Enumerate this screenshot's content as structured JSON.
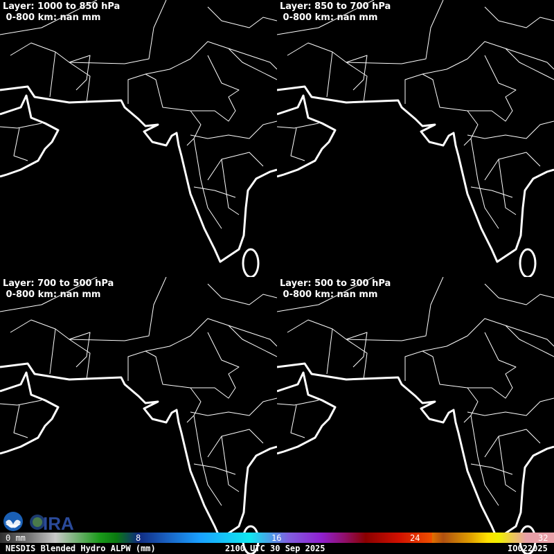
{
  "panels": [
    {
      "layer": "Layer: 1000 to 850 hPa",
      "stat": " 0-800 km: nan mm"
    },
    {
      "layer": "Layer: 850 to 700 hPa",
      "stat": " 0-800 km: nan mm"
    },
    {
      "layer": "Layer: 700 to 500 hPa",
      "stat": " 0-800 km: nan mm"
    },
    {
      "layer": "Layer: 500 to 300 hPa",
      "stat": " 0-800 km: nan mm"
    }
  ],
  "colorbar": {
    "ticks": [
      "0 mm",
      "8",
      "16",
      "24",
      "32"
    ]
  },
  "footer": {
    "product": "NESDIS Blended Hydro ALPW (mm)",
    "time": "2100 UTC 30 Sep 2025",
    "id": "IO022025"
  },
  "logos": {
    "noaa": "NOAA",
    "cira": "CIRA"
  }
}
